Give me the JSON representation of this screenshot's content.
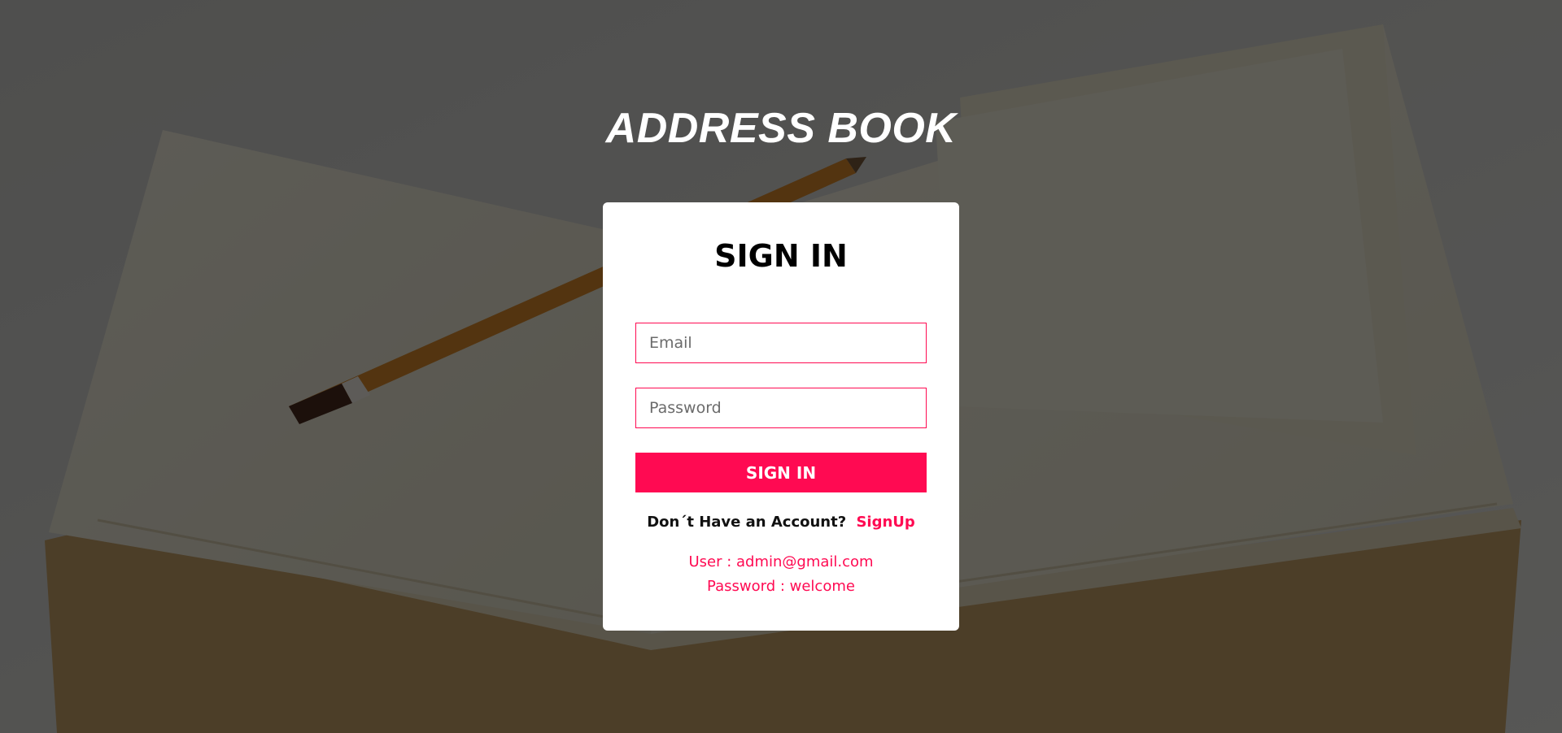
{
  "header": {
    "title": "ADDRESS BOOK"
  },
  "login_card": {
    "heading": "SIGN IN",
    "email_placeholder": "Email",
    "password_placeholder": "Password",
    "submit_label": "SIGN IN",
    "signup_prompt": "Don´t Have an Account?",
    "signup_link": "SignUp",
    "demo_user": "User : admin@gmail.com",
    "demo_password": "Password : welcome"
  },
  "background": {
    "image": "notebook-with-pencil-photo"
  },
  "colors": {
    "accent": "#ff0a52",
    "card": "#ffffff",
    "title": "#ffffff"
  }
}
